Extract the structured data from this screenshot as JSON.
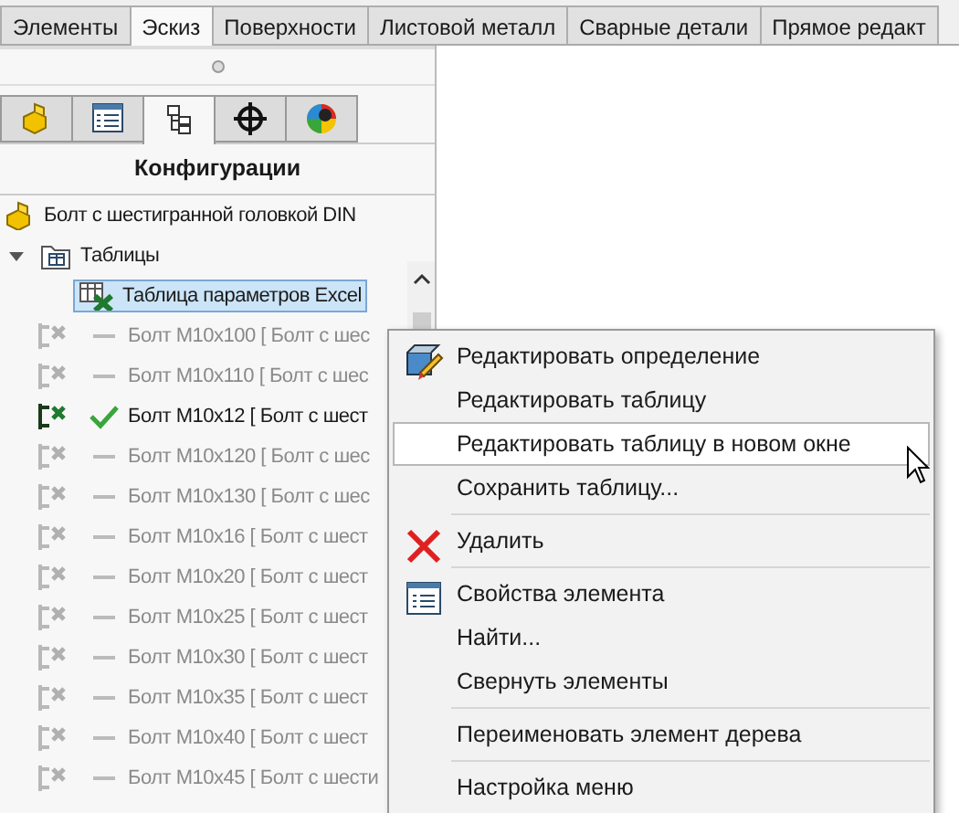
{
  "tabs": [
    {
      "label": "Элементы",
      "selected": false
    },
    {
      "label": "Эскиз",
      "selected": true
    },
    {
      "label": "Поверхности",
      "selected": false
    },
    {
      "label": "Листовой металл",
      "selected": false
    },
    {
      "label": "Сварные детали",
      "selected": false
    },
    {
      "label": "Прямое редакт",
      "selected": false
    }
  ],
  "panel_tabs": [
    {
      "kind": "part",
      "selected": false
    },
    {
      "kind": "properties",
      "selected": false
    },
    {
      "kind": "configurations",
      "selected": true
    },
    {
      "kind": "target",
      "selected": false
    },
    {
      "kind": "appearance",
      "selected": false
    }
  ],
  "panel_title": "Конфигурации",
  "tree": {
    "label": "Болт с шестигранной головкой DIN",
    "children": [
      {
        "label": "Таблицы",
        "expanded": true,
        "children": [
          {
            "label": "Таблица параметров Excel",
            "selected": true
          }
        ]
      },
      {
        "label": "Болт M10x100 [ Болт с шес",
        "active": false
      },
      {
        "label": "Болт M10x110 [ Болт с шес",
        "active": false
      },
      {
        "label": "Болт M10x12 [ Болт с шест",
        "active": true
      },
      {
        "label": "Болт M10x120 [ Болт с шес",
        "active": false
      },
      {
        "label": "Болт M10x130 [ Болт с шес",
        "active": false
      },
      {
        "label": "Болт M10x16 [ Болт с шест",
        "active": false
      },
      {
        "label": "Болт M10x20 [ Болт с шест",
        "active": false
      },
      {
        "label": "Болт M10x25 [ Болт с шест",
        "active": false
      },
      {
        "label": "Болт M10x30 [ Болт с шест",
        "active": false
      },
      {
        "label": "Болт M10x35 [ Болт с шест",
        "active": false
      },
      {
        "label": "Болт M10x40 [ Болт с шест",
        "active": false
      },
      {
        "label": "Болт M10x45 [ Болт с шести",
        "active": false
      }
    ]
  },
  "context_menu": [
    {
      "label": "Редактировать определение",
      "kind": "edit",
      "hovered": false
    },
    {
      "label": "Редактировать таблицу",
      "hovered": false
    },
    {
      "label": "Редактировать таблицу в новом окне",
      "hovered": true
    },
    {
      "label": "Сохранить таблицу...",
      "hovered": false,
      "separator_after": true
    },
    {
      "label": "Удалить",
      "kind": "delete",
      "hovered": false,
      "separator_after": true
    },
    {
      "label": "Свойства элемента",
      "kind": "properties",
      "hovered": false
    },
    {
      "label": "Найти...",
      "hovered": false
    },
    {
      "label": "Свернуть элементы",
      "hovered": false,
      "separator_after": true
    },
    {
      "label": "Переименовать элемент дерева",
      "hovered": false,
      "separator_after": true
    },
    {
      "label": "Настройка меню",
      "hovered": false
    }
  ]
}
